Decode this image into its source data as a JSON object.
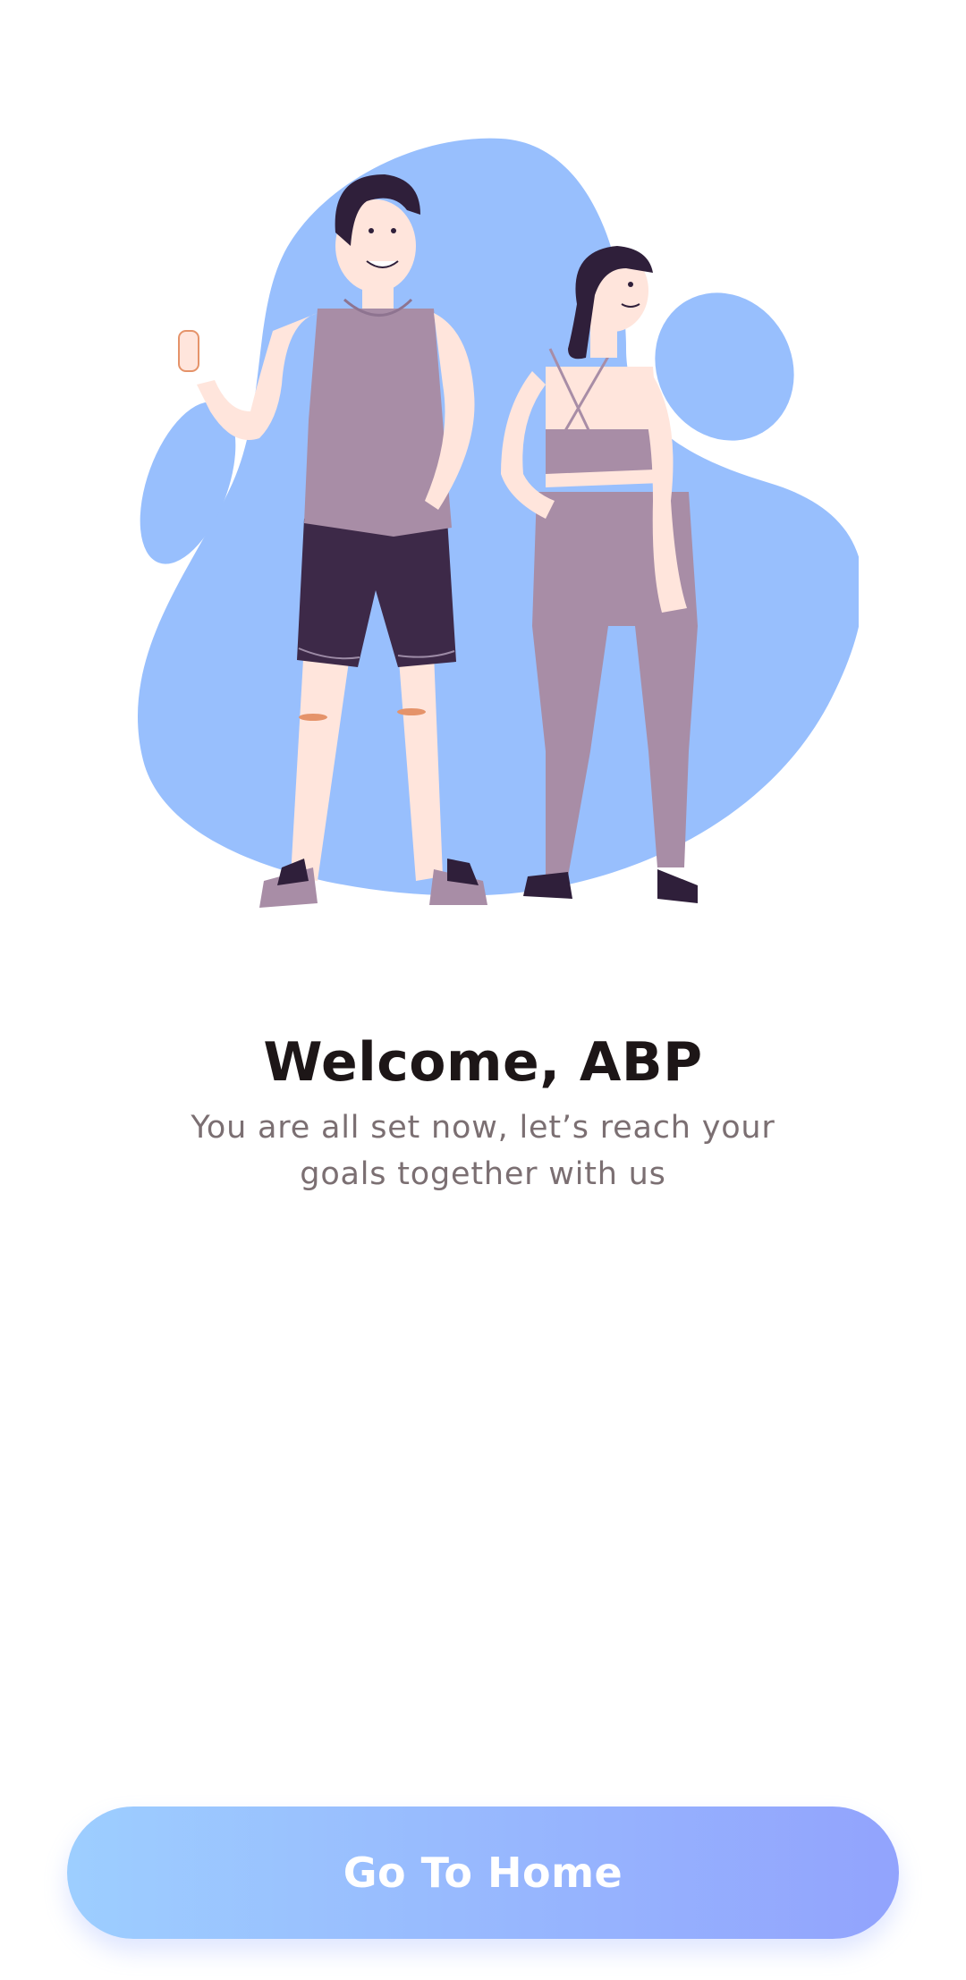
{
  "welcome": {
    "title": "Welcome, ABP",
    "subtitle": "You are all set now, let’s reach your goals together with us"
  },
  "actions": {
    "go_home_label": "Go To Home"
  },
  "illustration": {
    "icon": "fitness-couple-illustration",
    "blob_color": "#98BFFD"
  },
  "colors": {
    "title": "#1D1617",
    "subtitle": "#7B6F72",
    "button_gradient_start": "#9DCEFF",
    "button_gradient_end": "#92A3FD",
    "button_text": "#FFFFFF",
    "background": "#FFFFFF"
  }
}
